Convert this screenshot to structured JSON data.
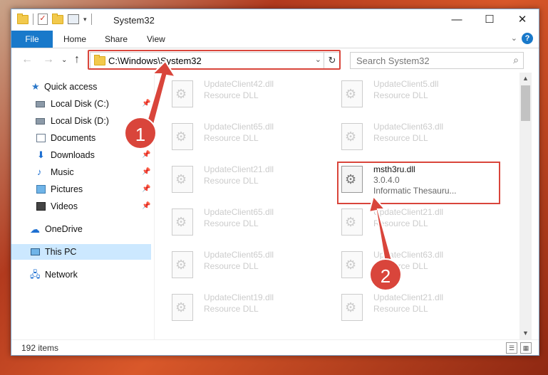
{
  "window": {
    "title": "System32"
  },
  "ribbon": {
    "tabs": [
      "File",
      "Home",
      "Share",
      "View"
    ],
    "help": "?"
  },
  "nav": {
    "address": "C:\\Windows\\System32",
    "search_placeholder": "Search System32"
  },
  "sidebar": {
    "items": [
      {
        "label": "Quick access"
      },
      {
        "label": "Local Disk (C:)"
      },
      {
        "label": "Local Disk (D:)"
      },
      {
        "label": "Documents"
      },
      {
        "label": "Downloads"
      },
      {
        "label": "Music"
      },
      {
        "label": "Pictures"
      },
      {
        "label": "Videos"
      },
      {
        "label": "OneDrive"
      },
      {
        "label": "This PC"
      },
      {
        "label": "Network"
      }
    ]
  },
  "files": [
    {
      "name": "UpdateClient42.dll",
      "type": "Resource DLL"
    },
    {
      "name": "UpdateClient5.dll",
      "type": "Resource DLL"
    },
    {
      "name": "UpdateClient65.dll",
      "type": "Resource DLL"
    },
    {
      "name": "UpdateClient63.dll",
      "type": "Resource DLL"
    },
    {
      "name": "UpdateClient21.dll",
      "type": "Resource DLL"
    },
    {
      "name": "msth3ru.dll",
      "version": "3.0.4.0",
      "description": "Informatic Thesauru..."
    },
    {
      "name": "UpdateClient65.dll",
      "type": "Resource DLL"
    },
    {
      "name": "UpdateClient21.dll",
      "type": "Resource DLL"
    },
    {
      "name": "UpdateClient65.dll",
      "type": "Resource DLL"
    },
    {
      "name": "UpdateClient63.dll",
      "type": "Resource DLL"
    },
    {
      "name": "UpdateClient19.dll",
      "type": "Resource DLL"
    },
    {
      "name": "UpdateClient21.dll",
      "type": "Resource DLL"
    }
  ],
  "status": {
    "items": "192 items"
  },
  "annotations": {
    "badge1": "1",
    "badge2": "2",
    "color": "#d9453b"
  },
  "colors": {
    "accent": "#1979ca",
    "selected": "#cce8ff"
  }
}
